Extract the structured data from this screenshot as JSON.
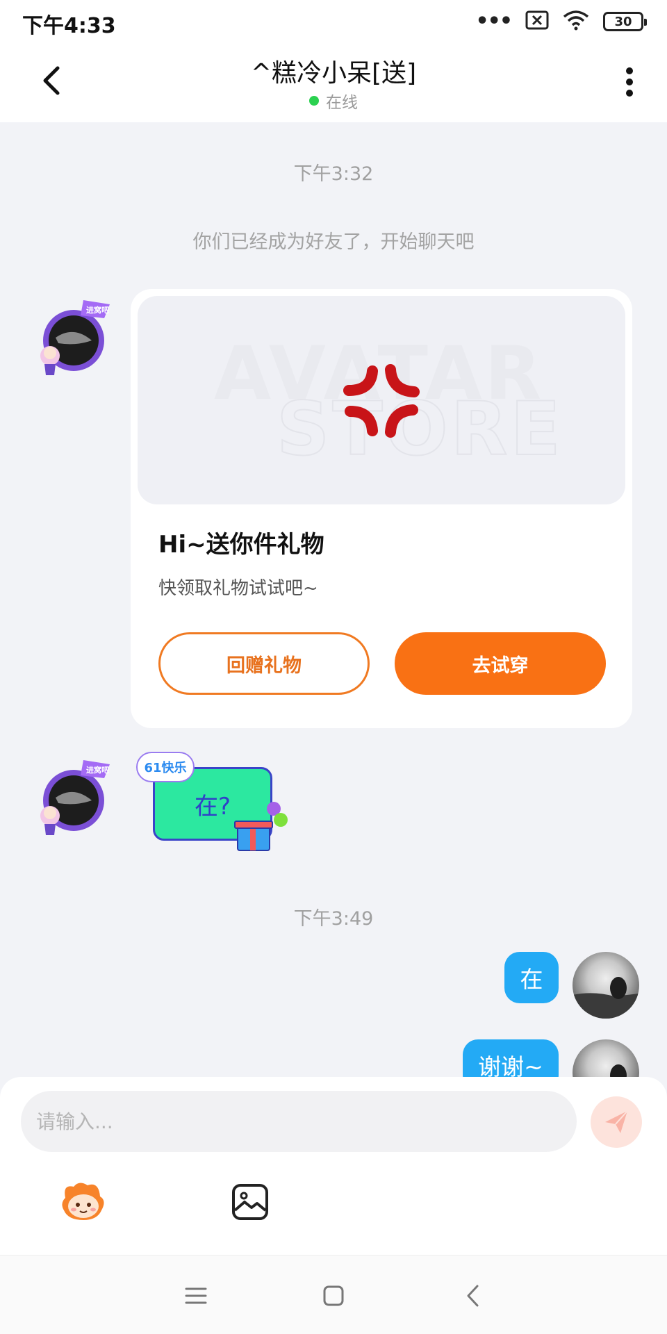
{
  "status_bar": {
    "time": "下午4:33",
    "battery": "30",
    "icons": [
      "more-dots-icon",
      "no-sim-icon",
      "wifi-icon",
      "battery-icon"
    ]
  },
  "header": {
    "title": "^糕冷小呆[送]",
    "status": "在线",
    "status_color": "#2bd150"
  },
  "chat": {
    "timestamp_1": "下午3:32",
    "system_message": "你们已经成为好友了，开始聊天吧",
    "gift_card": {
      "title": "Hi~送你件礼物",
      "subtitle": "快领取礼物试试吧~",
      "return_gift_label": "回赠礼物",
      "try_on_label": "去试穿",
      "accent_color": "#f97114",
      "preview_icon": "angry-vein-icon"
    },
    "sticker": {
      "badge": "61快乐",
      "text": "在?"
    },
    "timestamp_2": "下午3:49",
    "outgoing": [
      {
        "text": "在"
      },
      {
        "text": "谢谢~"
      }
    ],
    "bubble_color": "#23aaf5"
  },
  "input": {
    "placeholder": "请输入...",
    "value": ""
  },
  "toolbar": {
    "emoji_icon": "mascot-emoji-icon",
    "image_icon": "image-icon",
    "send_icon": "paper-plane-icon"
  },
  "nav": {
    "icons": [
      "menu-icon",
      "home-icon",
      "back-icon"
    ]
  }
}
